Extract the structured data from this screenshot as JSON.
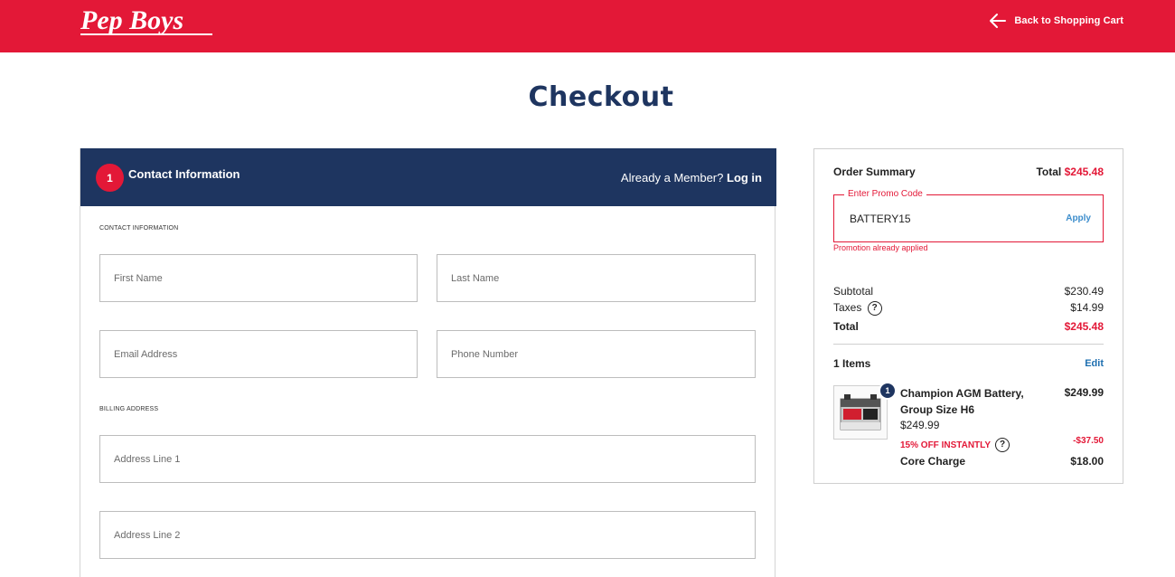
{
  "header": {
    "logo_text": "Pep Boys",
    "back_label": "Back to Shopping Cart",
    "brand_color": "#e31837"
  },
  "page": {
    "title": "Checkout"
  },
  "contact": {
    "step_number": "1",
    "title": "Contact Information",
    "member_prompt": "Already a Member?",
    "login_label": "Log in",
    "section_label": "CONTACT INFORMATION",
    "fields": {
      "first_name": "First Name",
      "last_name": "Last Name",
      "email": "Email Address",
      "phone": "Phone Number"
    }
  },
  "billing": {
    "section_label": "BILLING ADDRESS",
    "fields": {
      "address1": "Address Line 1",
      "address2": "Address Line 2"
    }
  },
  "summary": {
    "title": "Order Summary",
    "total_label": "Total",
    "total_value": "$245.48",
    "promo": {
      "legend": "Enter Promo Code",
      "value": "BATTERY15",
      "apply_label": "Apply",
      "message": "Promotion already applied"
    },
    "subtotal_label": "Subtotal",
    "subtotal_value": "$230.49",
    "taxes_label": "Taxes",
    "taxes_value": "$14.99",
    "grand_total_label": "Total",
    "grand_total_value": "$245.48",
    "items_label": "1 Items",
    "edit_label": "Edit",
    "item": {
      "quantity": "1",
      "name": "Champion AGM Battery, Group Size H6",
      "line_price": "$249.99",
      "unit_price": "$249.99",
      "discount_label": "15% OFF INSTANTLY",
      "discount_value": "-$37.50",
      "core_label": "Core Charge",
      "core_value": "$18.00"
    }
  },
  "colors": {
    "navy": "#1e3560",
    "red": "#e31837",
    "link_blue": "#1e6fb0"
  },
  "icons": {
    "back": "arrow-left-icon",
    "help": "question-circle-icon"
  }
}
